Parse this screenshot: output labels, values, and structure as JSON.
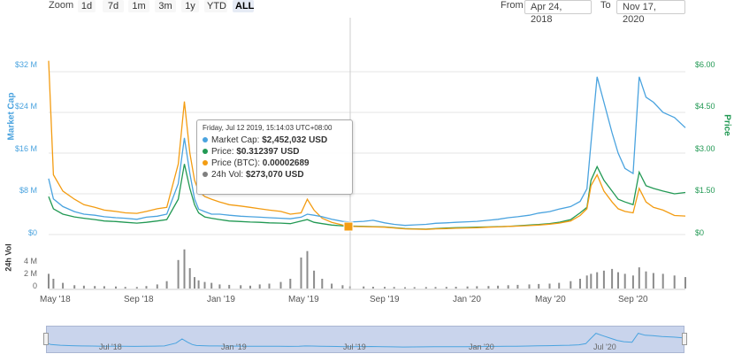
{
  "toolbar": {
    "zoom_label": "Zoom",
    "zoom_buttons": [
      "1d",
      "7d",
      "1m",
      "3m",
      "1y",
      "YTD",
      "ALL"
    ],
    "active_zoom": "ALL",
    "from_label": "From",
    "from_value": "Apr 24, 2018",
    "to_label": "To",
    "to_value": "Nov 17, 2020"
  },
  "axes": {
    "left_title": "Market Cap",
    "right_title": "Price",
    "volume_title": "24h Vol",
    "left_ticks": [
      "$32 M",
      "$24 M",
      "$16 M",
      "$8 M",
      "$0"
    ],
    "right_ticks": [
      "$6.00",
      "$4.50",
      "$3.00",
      "$1.50",
      "$0"
    ],
    "volume_ticks": [
      "4 M",
      "2 M",
      "0"
    ],
    "x_ticks": [
      "May '18",
      "Sep '18",
      "Jan '19",
      "May '19",
      "Sep '19",
      "Jan '20",
      "May '20",
      "Sep '20"
    ],
    "navigator_ticks": [
      "Jul '18",
      "Jan '19",
      "Jul '19",
      "Jan '20",
      "Jul '20"
    ]
  },
  "tooltip": {
    "header": "Friday, Jul 12 2019, 15:14:03 UTC+08:00",
    "rows": [
      {
        "label": "Market Cap:",
        "value": "$2,452,032 USD",
        "color": "#4aa3df"
      },
      {
        "label": "Price:",
        "value": "$0.312397 USD",
        "color": "#229954"
      },
      {
        "label": "Price (BTC):",
        "value": "0.00002689",
        "color": "#f39c12"
      },
      {
        "label": "24h Vol:",
        "value": "$273,070 USD",
        "color": "#7f7f7f"
      }
    ]
  },
  "colors": {
    "market_cap": "#4aa3df",
    "price_usd": "#229954",
    "price_btc": "#f39c12",
    "volume": "#8c8c8c"
  },
  "chart_data": {
    "type": "line",
    "x": [
      "2018-04-24",
      "2018-05-01",
      "2018-05-15",
      "2018-06-01",
      "2018-06-15",
      "2018-07-01",
      "2018-07-15",
      "2018-08-01",
      "2018-08-15",
      "2018-09-01",
      "2018-09-15",
      "2018-10-01",
      "2018-10-15",
      "2018-11-01",
      "2018-11-10",
      "2018-11-18",
      "2018-11-25",
      "2018-12-01",
      "2018-12-10",
      "2018-12-20",
      "2019-01-01",
      "2019-01-15",
      "2019-02-01",
      "2019-02-15",
      "2019-03-01",
      "2019-03-15",
      "2019-04-01",
      "2019-04-15",
      "2019-05-01",
      "2019-05-10",
      "2019-05-20",
      "2019-06-01",
      "2019-06-15",
      "2019-07-01",
      "2019-07-12",
      "2019-08-01",
      "2019-08-15",
      "2019-09-01",
      "2019-09-15",
      "2019-10-01",
      "2019-10-15",
      "2019-11-01",
      "2019-11-15",
      "2019-12-01",
      "2019-12-15",
      "2020-01-01",
      "2020-01-15",
      "2020-02-01",
      "2020-02-15",
      "2020-03-01",
      "2020-03-15",
      "2020-04-01",
      "2020-04-15",
      "2020-05-01",
      "2020-05-15",
      "2020-06-01",
      "2020-06-15",
      "2020-06-25",
      "2020-07-01",
      "2020-07-10",
      "2020-07-20",
      "2020-08-01",
      "2020-08-10",
      "2020-08-20",
      "2020-09-01",
      "2020-09-10",
      "2020-09-20",
      "2020-10-01",
      "2020-10-15",
      "2020-11-01",
      "2020-11-17"
    ],
    "series": [
      {
        "name": "Market Cap",
        "axis": "left",
        "values": [
          11,
          7,
          5.5,
          4.5,
          4,
          3.8,
          3.5,
          3.3,
          3.2,
          3,
          3.4,
          3.6,
          4,
          10,
          19,
          12,
          7,
          5,
          4.5,
          4,
          4,
          3.8,
          3.6,
          3.5,
          3.4,
          3.3,
          3.2,
          3.1,
          3.4,
          4,
          3.8,
          3.5,
          3,
          2.6,
          2.45,
          2.6,
          2.8,
          2.3,
          2,
          1.8,
          1.9,
          2,
          2.2,
          2.3,
          2.4,
          2.5,
          2.6,
          2.8,
          3,
          3.3,
          3.5,
          3.8,
          4.2,
          4.5,
          5,
          5.5,
          6.5,
          9,
          18,
          31,
          26,
          20,
          16,
          13,
          12,
          31,
          27,
          26,
          24,
          23,
          21
        ]
      },
      {
        "name": "Price",
        "axis": "right",
        "values": [
          1.4,
          0.95,
          0.75,
          0.65,
          0.6,
          0.55,
          0.5,
          0.48,
          0.45,
          0.42,
          0.45,
          0.5,
          0.55,
          1.3,
          2.6,
          1.7,
          1.1,
          0.8,
          0.65,
          0.6,
          0.55,
          0.5,
          0.48,
          0.46,
          0.45,
          0.43,
          0.42,
          0.4,
          0.5,
          0.55,
          0.45,
          0.4,
          0.35,
          0.32,
          0.3124,
          0.3,
          0.29,
          0.28,
          0.25,
          0.22,
          0.21,
          0.2,
          0.22,
          0.24,
          0.25,
          0.26,
          0.27,
          0.28,
          0.29,
          0.3,
          0.32,
          0.35,
          0.37,
          0.4,
          0.45,
          0.55,
          0.8,
          1.0,
          2.0,
          2.5,
          2.0,
          1.6,
          1.3,
          1.2,
          1.1,
          2.3,
          1.8,
          1.7,
          1.6,
          1.5,
          1.55
        ]
      },
      {
        "name": "Price (BTC)",
        "axis": "right",
        "values": [
          6.4,
          2.2,
          1.6,
          1.3,
          1.1,
          1.0,
          0.9,
          0.85,
          0.8,
          0.78,
          0.85,
          0.95,
          1.0,
          2.6,
          4.9,
          3.0,
          2.0,
          1.6,
          1.4,
          1.3,
          1.2,
          1.1,
          1.05,
          1.0,
          0.95,
          0.9,
          0.85,
          0.75,
          0.8,
          1.3,
          0.9,
          0.6,
          0.45,
          0.35,
          0.3,
          0.29,
          0.28,
          0.27,
          0.24,
          0.21,
          0.2,
          0.19,
          0.21,
          0.22,
          0.23,
          0.24,
          0.25,
          0.27,
          0.28,
          0.3,
          0.31,
          0.33,
          0.35,
          0.38,
          0.42,
          0.5,
          0.7,
          0.95,
          1.8,
          2.2,
          1.6,
          1.2,
          0.95,
          0.85,
          0.8,
          1.7,
          1.2,
          1.0,
          0.9,
          0.7,
          0.68
        ]
      },
      {
        "name": "24h Vol",
        "axis": "volume",
        "values": [
          1.8,
          1.2,
          0.7,
          0.4,
          0.35,
          0.3,
          0.28,
          0.25,
          0.2,
          0.18,
          0.3,
          0.5,
          0.9,
          3.5,
          4.8,
          2.5,
          1.4,
          1.0,
          0.8,
          0.7,
          0.5,
          0.45,
          0.4,
          0.35,
          0.5,
          0.6,
          0.8,
          1.2,
          3.8,
          4.6,
          2.2,
          1.2,
          0.6,
          0.4,
          0.27,
          0.25,
          0.22,
          0.2,
          0.18,
          0.15,
          0.16,
          0.17,
          0.18,
          0.2,
          0.22,
          0.25,
          0.28,
          0.3,
          0.35,
          0.4,
          0.45,
          0.5,
          0.55,
          0.6,
          0.7,
          0.9,
          1.2,
          1.6,
          1.8,
          2.0,
          2.2,
          2.4,
          2.0,
          1.8,
          1.6,
          2.6,
          2.1,
          1.9,
          1.8,
          1.6,
          1.4
        ]
      }
    ],
    "left_axis_range": [
      0,
      36
    ],
    "right_axis_range": [
      0,
      6.75
    ],
    "volume_axis_range": [
      0,
      5
    ],
    "grid": true
  }
}
